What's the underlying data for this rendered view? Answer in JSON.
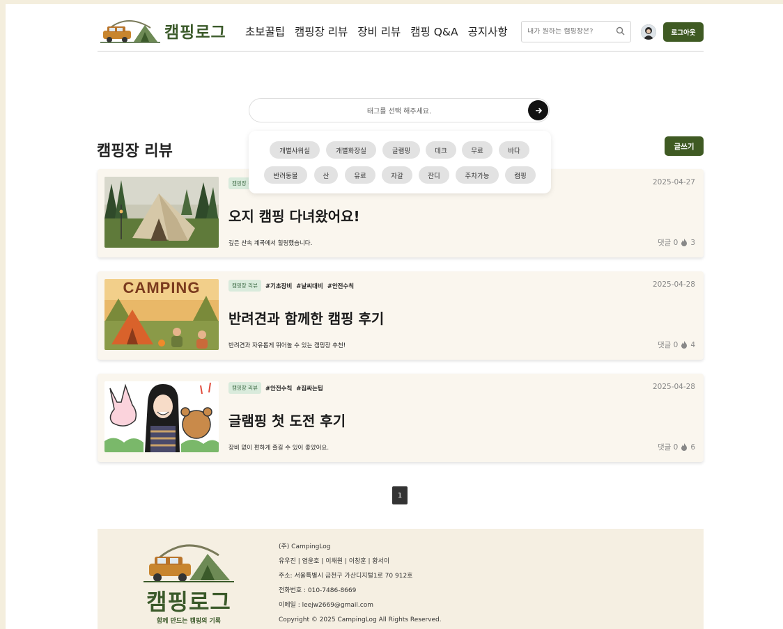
{
  "header": {
    "logo_text": "캠핑로그",
    "nav": [
      "초보꿀팁",
      "캠핑장 리뷰",
      "장비 리뷰",
      "캠핑 Q&A",
      "공지사항"
    ],
    "search_placeholder": "내가 원하는 캠핑장은?",
    "logout_label": "로그아웃"
  },
  "tag_search": {
    "placeholder": "태그를 선택 해주세요.",
    "tags_row1": [
      "개별샤워실",
      "개별화장실",
      "글램핑",
      "데크",
      "무료",
      "바다"
    ],
    "tags_row2": [
      "반려동물",
      "산",
      "유료",
      "자갈",
      "잔디",
      "주차가능",
      "캠핑"
    ]
  },
  "main": {
    "title": "캠핑장 리뷰",
    "write_label": "글쓰기"
  },
  "posts": [
    {
      "category": "캠핑장 리뷰",
      "tags": [],
      "title": "오지 캠핑 다녀왔어요!",
      "desc": "깊은 산속 계곡에서 힐링했습니다.",
      "date": "2025-04-27",
      "comments": "댓글 0",
      "likes": "3"
    },
    {
      "category": "캠핑장 리뷰",
      "tags": [
        "#기초장비",
        "#날씨대비",
        "#안전수칙"
      ],
      "title": "반려견과 함께한 캠핑 후기",
      "desc": "반려견과 자유롭게 뛰어놀 수 있는 캠핑장 추천!",
      "date": "2025-04-28",
      "comments": "댓글 0",
      "likes": "4",
      "thumb_text": "CAMPING"
    },
    {
      "category": "캠핑장 리뷰",
      "tags": [
        "#안전수칙",
        "#짐싸는팁"
      ],
      "title": "글램핑 첫 도전 후기",
      "desc": "장비 없이 편하게 즐길 수 있어 좋았어요.",
      "date": "2025-04-28",
      "comments": "댓글 0",
      "likes": "6"
    }
  ],
  "pagination": {
    "current": "1"
  },
  "footer": {
    "logo_text": "캠핑로그",
    "slogan": "함께 만드는 캠핑의 기록",
    "company": "(주) CampingLog",
    "members": "유우진 | 염윤호 | 이채원 | 이창훈 | 황서이",
    "address": "주소: 서울특별시 금천구 가산디지털1로 70 912호",
    "phone": "전화번호 : 010-7486-8669",
    "email": "이메일 : leejw2669@gmail.com",
    "copyright": "Copyright © 2025 CampingLog All Rights Reserved."
  },
  "colors": {
    "brand_green": "#3f5a23",
    "card_bg": "#faf6ee",
    "badge_bg": "#d9ebdc"
  }
}
